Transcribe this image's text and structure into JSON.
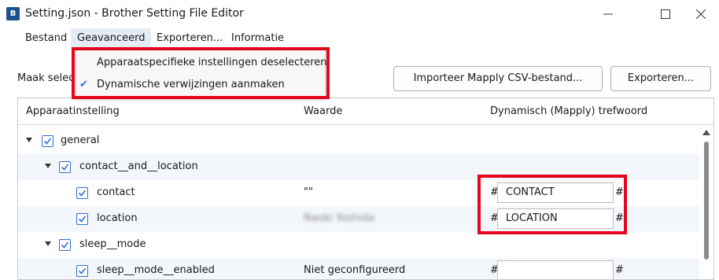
{
  "window": {
    "title": "Setting.json - Brother Setting File Editor",
    "icon_text": "B",
    "minimize_icon": "minimize-icon",
    "maximize_icon": "maximize-icon",
    "close_icon": "close-icon"
  },
  "menubar": {
    "items": [
      "Bestand",
      "Geavanceerd",
      "Exporteren...",
      "Informatie"
    ],
    "active": "Geavanceerd"
  },
  "dropdown": {
    "items": [
      {
        "label": "Apparaatspecifieke instellingen deselecteren",
        "checked": false
      },
      {
        "label": "Dynamische verwijzingen aanmaken",
        "checked": true
      }
    ]
  },
  "toolbar": {
    "label": "Maak selec",
    "import_button": "Importeer Mapply CSV-bestand...",
    "export_button": "Exporteren..."
  },
  "tree": {
    "columns": [
      "Apparaatinstelling",
      "Waarde",
      "Dynamisch (Mapply) trefwoord"
    ],
    "rows": [
      {
        "label": "general",
        "value": "",
        "keyword": null,
        "checked": true
      },
      {
        "label": "contact__and__location",
        "value": "",
        "keyword": null,
        "checked": true
      },
      {
        "label": "contact",
        "value": "\"\"",
        "keyword": "CONTACT",
        "checked": true
      },
      {
        "label": "location",
        "value": "Naoki Yoshida",
        "keyword": "LOCATION",
        "checked": true
      },
      {
        "label": "sleep__mode",
        "value": "",
        "keyword": null,
        "checked": true
      },
      {
        "label": "sleep__mode__enabled",
        "value": "Niet geconfigureerd",
        "keyword": "",
        "checked": true
      }
    ],
    "hash_symbol": "#"
  },
  "colors": {
    "highlight": "#e3071d",
    "checkbox": "#2f6fd6",
    "menu_active": "#e5ecf5",
    "row_alt": "#f3f6fb"
  }
}
